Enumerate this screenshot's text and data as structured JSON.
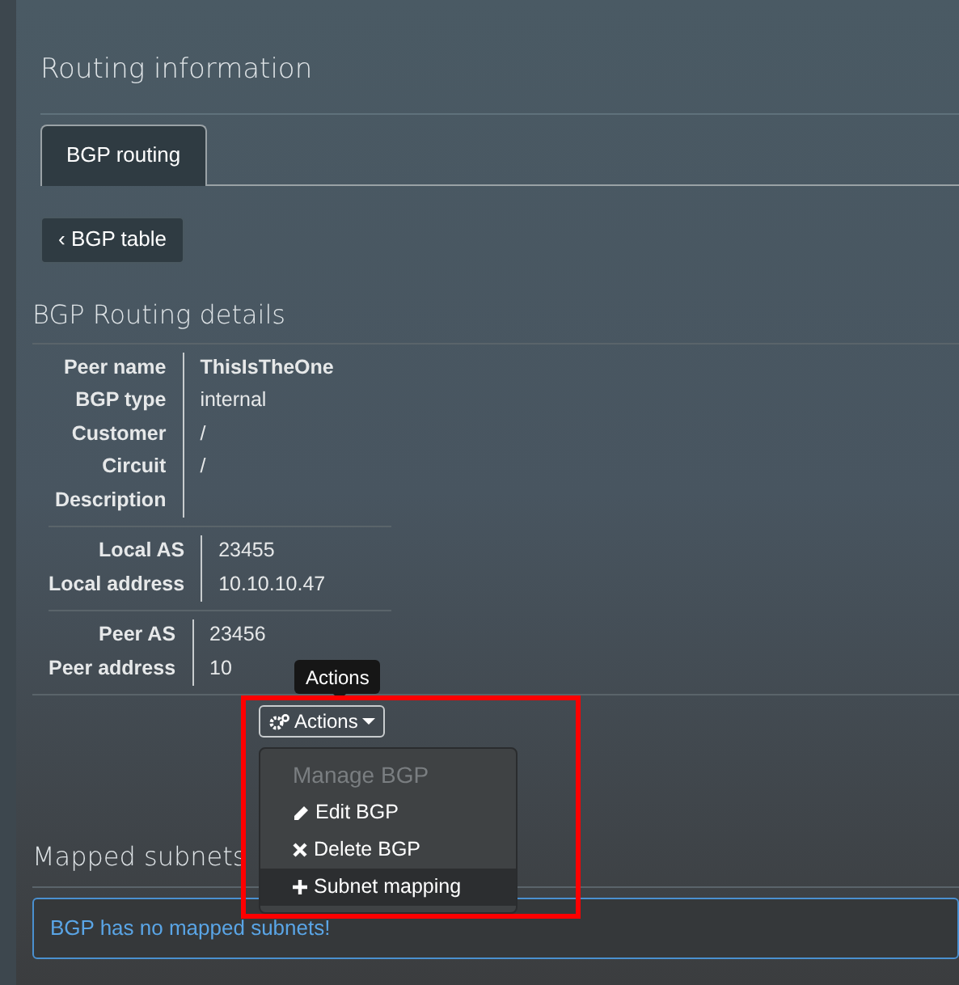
{
  "page_title": "Routing information",
  "tabs": [
    {
      "label": "BGP routing",
      "selected": true
    }
  ],
  "back_button": "‹ BGP table",
  "details_title": "BGP Routing details",
  "detail_groups": [
    [
      {
        "label": "Peer name",
        "value": "ThisIsTheOne",
        "bold": true
      },
      {
        "label": "BGP type",
        "value": "internal",
        "bold": false
      },
      {
        "label": "Customer",
        "value": "/",
        "bold": false
      },
      {
        "label": "Circuit",
        "value": "/",
        "bold": false
      },
      {
        "label": "Description"
      }
    ],
    [
      {
        "label": "Local AS",
        "value": "23455",
        "bold": false
      },
      {
        "label": "Local address",
        "value": "10.10.10.47",
        "bold": false
      }
    ],
    [
      {
        "label": "Peer AS",
        "value": "23456",
        "bold": false
      },
      {
        "label": "Peer address",
        "value": "10",
        "bold": false
      }
    ]
  ],
  "actions": {
    "tooltip": "Actions",
    "button": "Actions",
    "expanded": true,
    "menu": [
      {
        "kind": "header",
        "label": "Manage BGP"
      },
      {
        "kind": "item",
        "label": "Edit BGP",
        "hovered": false
      },
      {
        "kind": "item",
        "label": "Delete BGP",
        "hovered": false
      },
      {
        "kind": "item",
        "label": "Subnet mapping",
        "hovered": true
      }
    ]
  },
  "mapped_title": "Mapped subnets",
  "mapped_alert": "BGP has no mapped subnets!"
}
